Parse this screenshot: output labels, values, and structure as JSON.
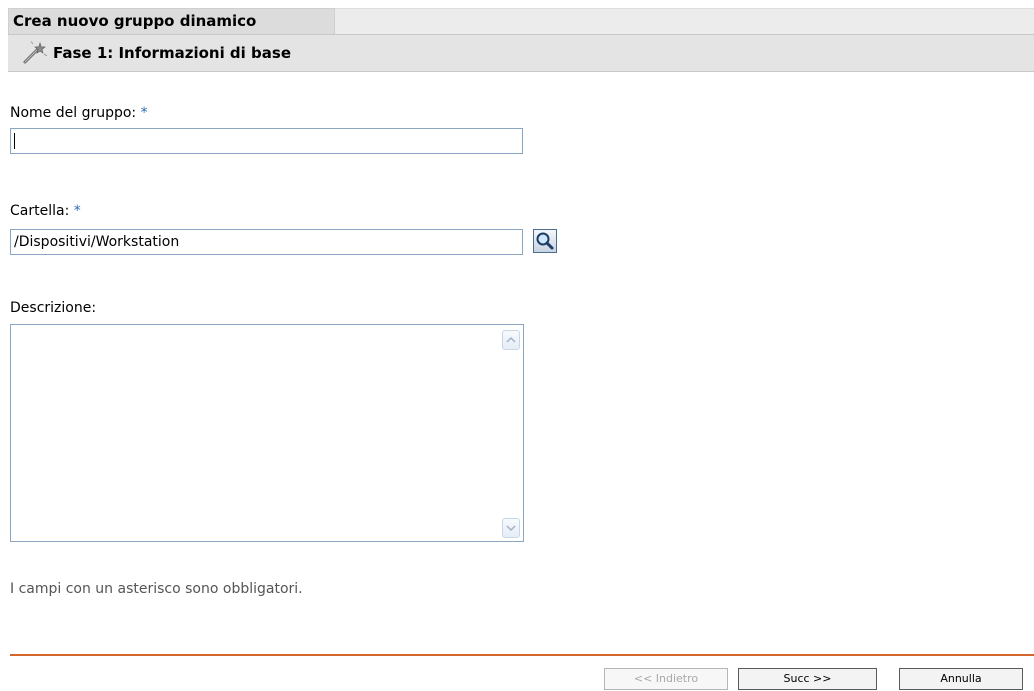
{
  "header": {
    "title": "Crea nuovo gruppo dinamico",
    "step_title": "Fase 1: Informazioni di base"
  },
  "form": {
    "group_name": {
      "label": "Nome del gruppo:",
      "required_mark": "*",
      "value": ""
    },
    "folder": {
      "label": "Cartella:",
      "required_mark": "*",
      "value": "/Dispositivi/Workstation"
    },
    "description": {
      "label": "Descrizione:",
      "value": ""
    }
  },
  "note": "I campi con un asterisco sono obbligatori.",
  "footer": {
    "back_label": "<< Indietro",
    "next_label": "Succ >>",
    "cancel_label": "Annulla"
  },
  "icons": {
    "step": "wand-icon",
    "browse": "magnifier-icon",
    "scroll_up": "chevron-up-icon",
    "scroll_down": "chevron-down-icon"
  },
  "colors": {
    "required_asterisk": "#2a6db6",
    "divider": "#d3652f",
    "input_border": "#8aa6c1"
  }
}
